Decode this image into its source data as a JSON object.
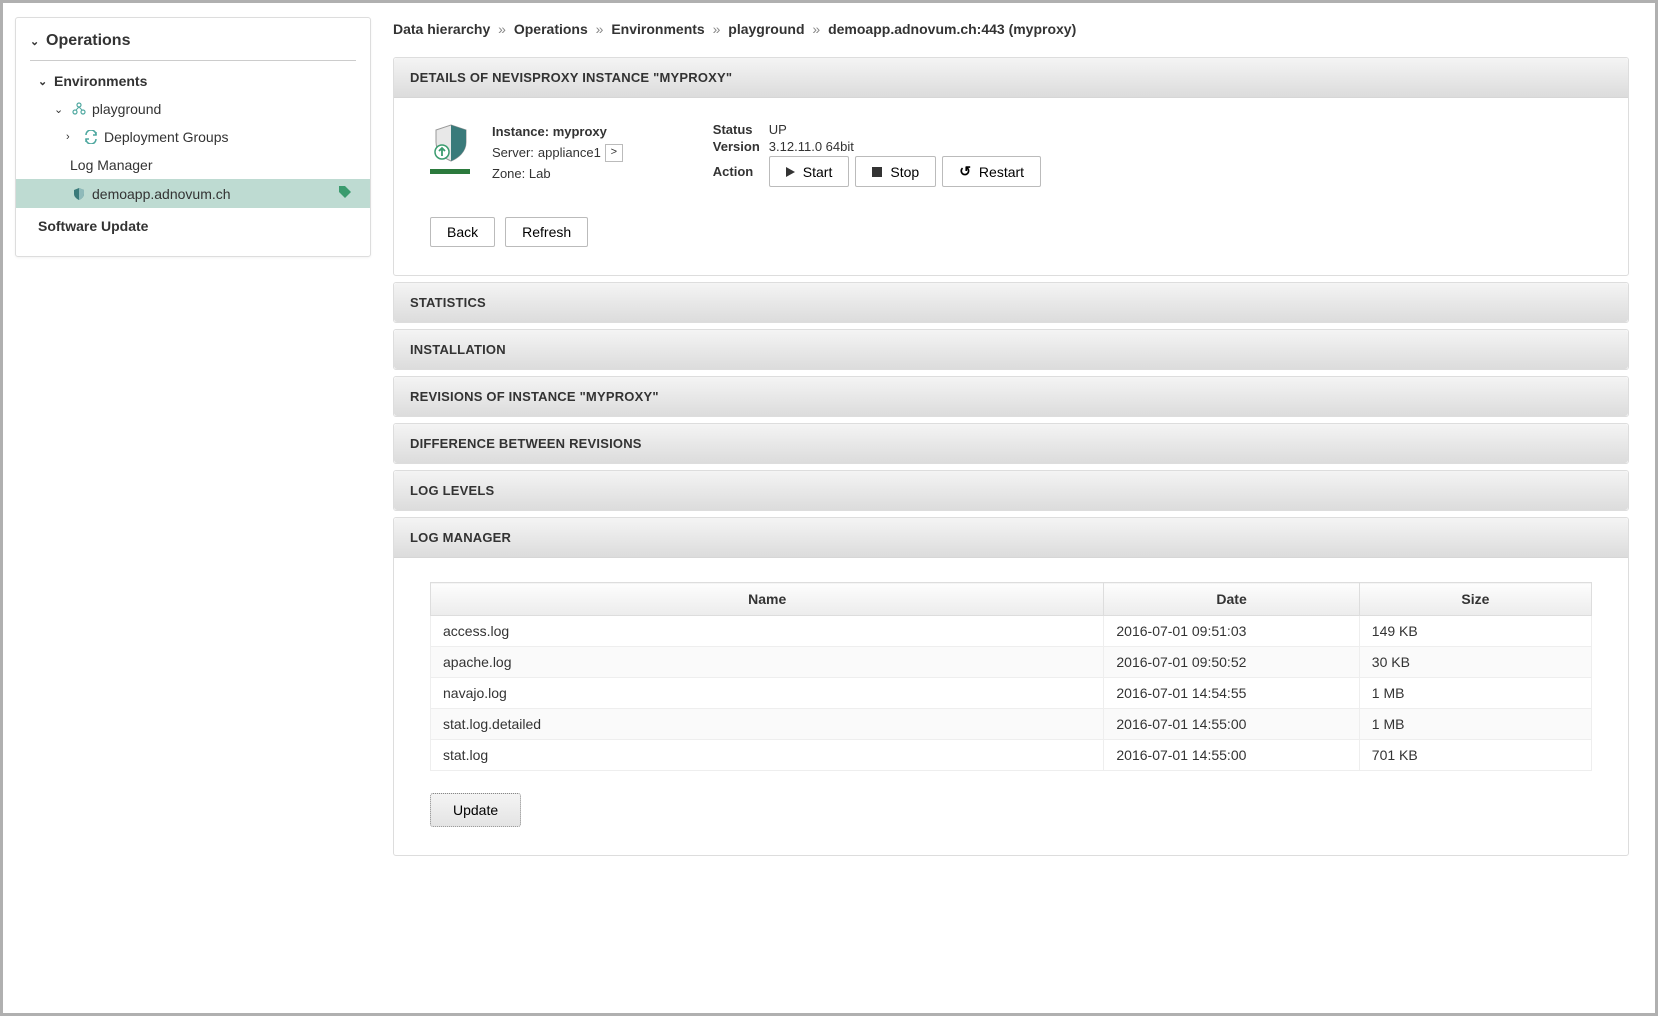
{
  "sidebar": {
    "operations": "Operations",
    "environments": "Environments",
    "playground": "playground",
    "deployment_groups": "Deployment Groups",
    "log_manager": "Log Manager",
    "demoapp": "demoapp.adnovum.ch",
    "software_update": "Software Update"
  },
  "breadcrumb": {
    "root": "Data hierarchy",
    "p1": "Operations",
    "p2": "Environments",
    "p3": "playground",
    "p4": "demoapp.adnovum.ch:443 (myproxy)"
  },
  "details": {
    "header": "DETAILS OF NEVISPROXY INSTANCE \"MYPROXY\"",
    "instance_label": "Instance:",
    "instance_value": "myproxy",
    "server_label": "Server:",
    "server_value": "appliance1",
    "zone_label": "Zone:",
    "zone_value": "Lab",
    "status_label": "Status",
    "status_value": "UP",
    "version_label": "Version",
    "version_value": "3.12.11.0 64bit",
    "action_label": "Action",
    "start": "Start",
    "stop": "Stop",
    "restart": "Restart",
    "back": "Back",
    "refresh": "Refresh"
  },
  "panels": {
    "statistics": "STATISTICS",
    "installation": "INSTALLATION",
    "revisions": "REVISIONS OF INSTANCE \"MYPROXY\"",
    "diff": "DIFFERENCE BETWEEN REVISIONS",
    "loglevels": "LOG LEVELS",
    "logmanager": "LOG MANAGER"
  },
  "log_table": {
    "columns": {
      "name": "Name",
      "date": "Date",
      "size": "Size"
    },
    "rows": [
      {
        "name": "access.log",
        "date": "2016-07-01 09:51:03",
        "size": "149 KB"
      },
      {
        "name": "apache.log",
        "date": "2016-07-01 09:50:52",
        "size": "30 KB"
      },
      {
        "name": "navajo.log",
        "date": "2016-07-01 14:54:55",
        "size": "1 MB"
      },
      {
        "name": "stat.log.detailed",
        "date": "2016-07-01 14:55:00",
        "size": "1 MB"
      },
      {
        "name": "stat.log",
        "date": "2016-07-01 14:55:00",
        "size": "701 KB"
      }
    ],
    "update": "Update"
  }
}
